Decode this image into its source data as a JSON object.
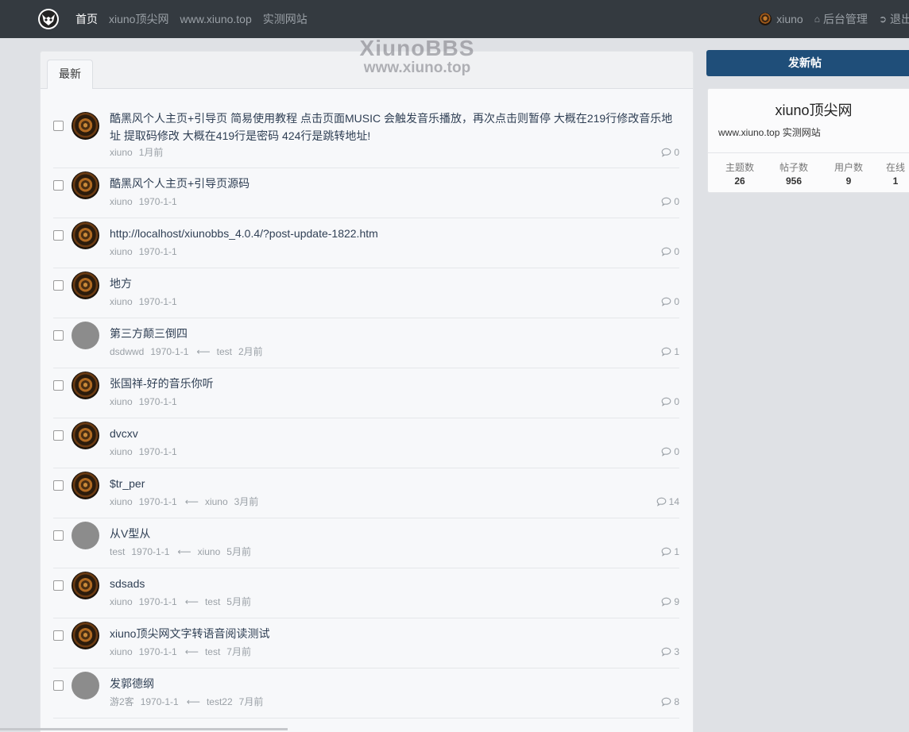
{
  "nav": {
    "items": [
      "首页",
      "xiuno顶尖网",
      "www.xiuno.top",
      "实测网站"
    ],
    "user": "xiuno",
    "admin": "后台管理",
    "logout": "退出"
  },
  "watermark": {
    "line1": "XiunoBBS",
    "line2": "www.xiuno.top"
  },
  "tabs": {
    "latest": "最新"
  },
  "threads": [
    {
      "title": "酷黑风个人主页+引导页 简易使用教程 点击页面MUSIC 会触发音乐播放，再次点击则暂停 大概在219行修改音乐地址 提取码修改 大概在419行是密码 424行是跳转地址!",
      "author": "xiuno",
      "date": "1月前",
      "last_user": "",
      "last_date": "",
      "replies": "0",
      "avatar": "dark"
    },
    {
      "title": "酷黑风个人主页+引导页源码",
      "author": "xiuno",
      "date": "1970-1-1",
      "last_user": "",
      "last_date": "",
      "replies": "0",
      "avatar": "dark"
    },
    {
      "title": "http://localhost/xiunobbs_4.0.4/?post-update-1822.htm",
      "author": "xiuno",
      "date": "1970-1-1",
      "last_user": "",
      "last_date": "",
      "replies": "0",
      "avatar": "dark"
    },
    {
      "title": "地方",
      "author": "xiuno",
      "date": "1970-1-1",
      "last_user": "",
      "last_date": "",
      "replies": "0",
      "avatar": "dark"
    },
    {
      "title": "第三方颠三倒四",
      "author": "dsdwwd",
      "date": "1970-1-1",
      "last_user": "test",
      "last_date": "2月前",
      "replies": "1",
      "avatar": "gray"
    },
    {
      "title": "张国祥-好的音乐你听",
      "author": "xiuno",
      "date": "1970-1-1",
      "last_user": "",
      "last_date": "",
      "replies": "0",
      "avatar": "dark"
    },
    {
      "title": "dvcxv",
      "author": "xiuno",
      "date": "1970-1-1",
      "last_user": "",
      "last_date": "",
      "replies": "0",
      "avatar": "dark"
    },
    {
      "title": "$tr_per",
      "author": "xiuno",
      "date": "1970-1-1",
      "last_user": "xiuno",
      "last_date": "3月前",
      "replies": "14",
      "avatar": "dark"
    },
    {
      "title": "从V型从",
      "author": "test",
      "date": "1970-1-1",
      "last_user": "xiuno",
      "last_date": "5月前",
      "replies": "1",
      "avatar": "gray"
    },
    {
      "title": "sdsads",
      "author": "xiuno",
      "date": "1970-1-1",
      "last_user": "test",
      "last_date": "5月前",
      "replies": "9",
      "avatar": "dark"
    },
    {
      "title": "xiuno顶尖网文字转语音阅读测试",
      "author": "xiuno",
      "date": "1970-1-1",
      "last_user": "test",
      "last_date": "7月前",
      "replies": "3",
      "avatar": "dark"
    },
    {
      "title": "发郭德纲",
      "author": "游2客",
      "date": "1970-1-1",
      "last_user": "test22",
      "last_date": "7月前",
      "replies": "8",
      "avatar": "gray"
    }
  ],
  "sidebar": {
    "new_post": "发新帖",
    "site_name": "xiuno顶尖网",
    "site_desc": "www.xiuno.top 实测网站",
    "stats": [
      {
        "label": "主题数",
        "value": "26"
      },
      {
        "label": "帖子数",
        "value": "956"
      },
      {
        "label": "用户数",
        "value": "9"
      },
      {
        "label": "在线",
        "value": "1"
      }
    ]
  },
  "colors": {
    "topbar": "#343a40",
    "primary": "#1f4e79",
    "background": "#dfe1e5"
  },
  "icons": {
    "logo": "xiuno-logo-icon",
    "home": "home-icon",
    "logout": "sign-out-icon",
    "reply": "comment-icon"
  }
}
